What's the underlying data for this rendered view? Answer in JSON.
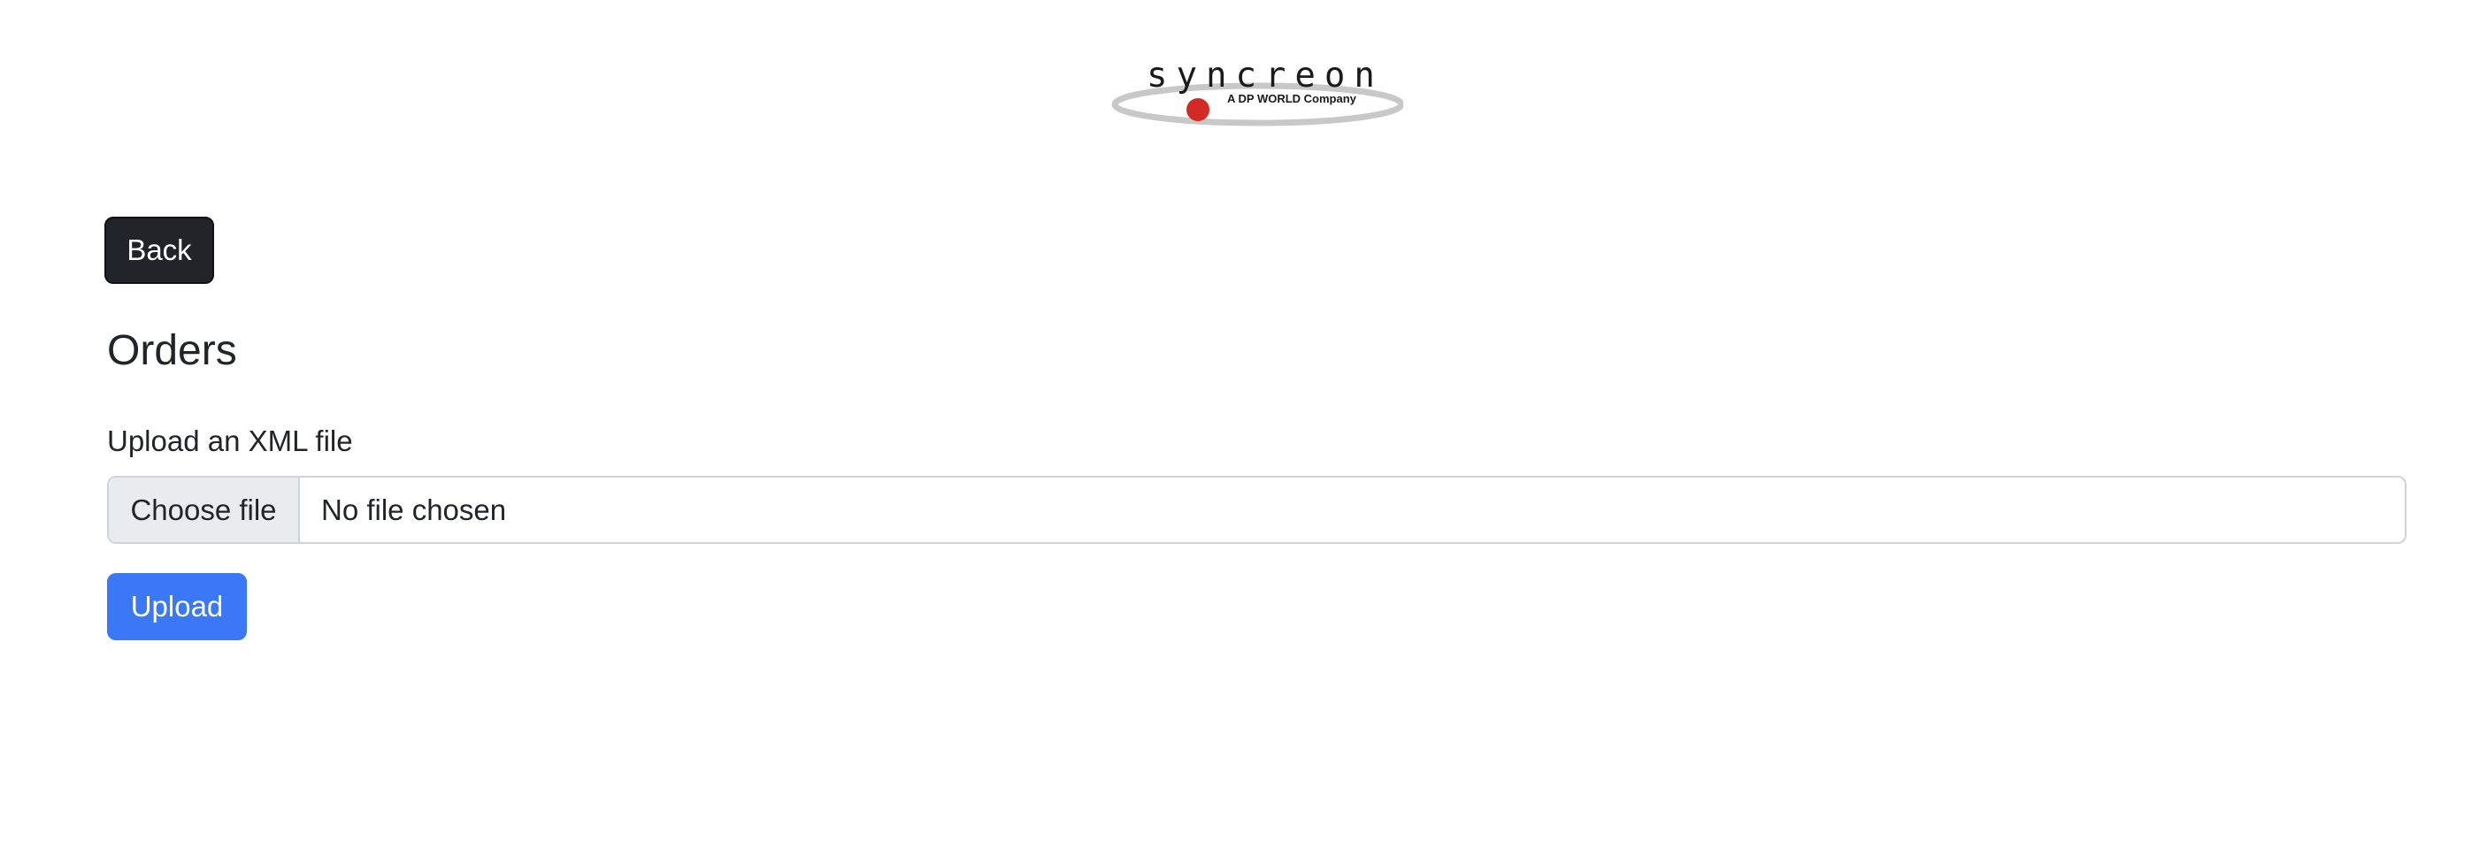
{
  "header": {
    "logo": {
      "brand": "syncreon",
      "tagline": "A DP WORLD Company",
      "icon": "syncreon-logo-icon",
      "colors": {
        "ring": "#c8c8c8",
        "dot": "#d42a26",
        "text": "#1a1a1a"
      }
    }
  },
  "nav": {
    "back_label": "Back"
  },
  "main": {
    "title": "Orders",
    "upload": {
      "label": "Upload an XML file",
      "choose_label": "Choose file",
      "file_status": "No file chosen",
      "submit_label": "Upload"
    }
  },
  "colors": {
    "back_button": "#212529",
    "primary": "#3a78f5",
    "input_border": "#ced4da",
    "choose_bg": "#e9ecef",
    "text": "#212529"
  }
}
